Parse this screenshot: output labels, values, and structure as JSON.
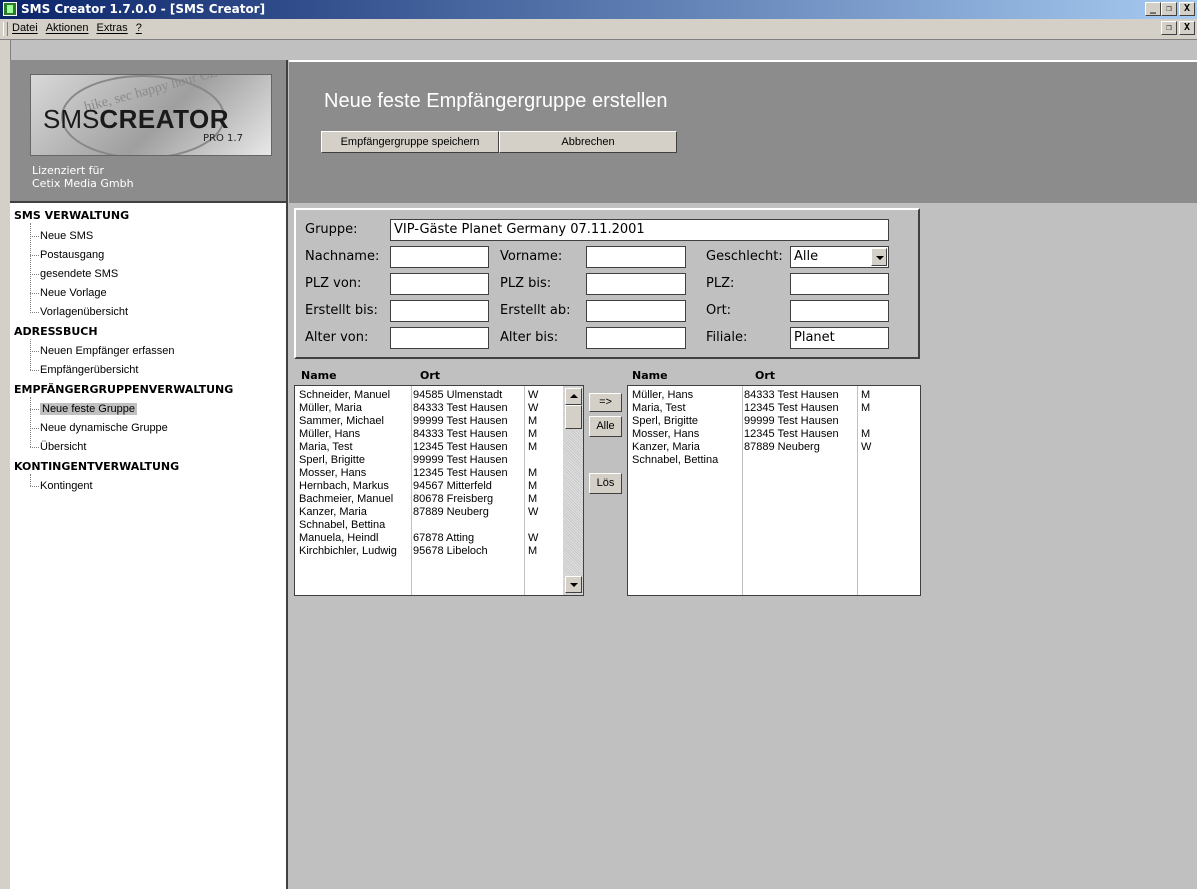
{
  "window": {
    "title": "SMS Creator 1.7.0.0 - [SMS Creator]",
    "buttons": {
      "minimize": "_",
      "restore": "8",
      "close": "X"
    }
  },
  "menubar": {
    "items": [
      "Datei",
      "Aktionen",
      "Extras",
      "?"
    ]
  },
  "sidebar": {
    "logo": {
      "tagline_bg": "hike, sec happy hour CLUB CAIRO ba",
      "word1": "SMS",
      "word2": "CREATOR",
      "edition": "PRO 1.7"
    },
    "license_line1": "Lizenziert für",
    "license_line2": "Cetix Media Gmbh",
    "sections": [
      {
        "title": "SMS VERWALTUNG",
        "items": [
          "Neue SMS",
          "Postausgang",
          "gesendete SMS",
          "Neue Vorlage",
          "Vorlagenübersicht"
        ]
      },
      {
        "title": "ADRESSBUCH",
        "items": [
          "Neuen Empfänger erfassen",
          "Empfängerübersicht"
        ]
      },
      {
        "title": "EMPFÄNGERGRUPPENVERWALTUNG",
        "items": [
          "Neue feste Gruppe",
          "Neue dynamische Gruppe",
          "Übersicht"
        ]
      },
      {
        "title": "KONTINGENTVERWALTUNG",
        "items": [
          "Kontingent"
        ]
      }
    ],
    "selected_item": "Neue feste Gruppe"
  },
  "banner": {
    "title": "Neue feste Empfängergruppe erstellen",
    "save_button": "Empfängergruppe speichern",
    "cancel_button": "Abbrechen"
  },
  "form": {
    "gruppe_label": "Gruppe:",
    "gruppe_value": "VIP-Gäste Planet Germany 07.11.2001",
    "nachname_label": "Nachname:",
    "nachname_value": "",
    "vorname_label": "Vorname:",
    "vorname_value": "",
    "geschlecht_label": "Geschlecht:",
    "geschlecht_value": "Alle",
    "plz_von_label": "PLZ von:",
    "plz_von_value": "",
    "plz_bis_label": "PLZ bis:",
    "plz_bis_value": "",
    "plz_label": "PLZ:",
    "plz_value": "",
    "erstellt_bis_label": "Erstellt bis:",
    "erstellt_bis_value": "",
    "erstellt_ab_label": "Erstellt ab:",
    "erstellt_ab_value": "",
    "ort_label": "Ort:",
    "ort_value": "",
    "alter_von_label": "Alter von:",
    "alter_von_value": "",
    "alter_bis_label": "Alter bis:",
    "alter_bis_value": "",
    "filiale_label": "Filiale:",
    "filiale_value": "Planet"
  },
  "available_list": {
    "headers": {
      "name": "Name",
      "ort": "Ort"
    },
    "rows": [
      {
        "name": "Schneider, Manuel",
        "ort": "94585 Ulmenstadt",
        "sex": "W"
      },
      {
        "name": "Müller, Maria",
        "ort": "84333 Test Hausen",
        "sex": "W"
      },
      {
        "name": "Sammer, Michael",
        "ort": "99999 Test Hausen",
        "sex": "M"
      },
      {
        "name": "Müller, Hans",
        "ort": "84333 Test Hausen",
        "sex": "M"
      },
      {
        "name": "Maria, Test",
        "ort": "12345 Test Hausen",
        "sex": "M"
      },
      {
        "name": "Sperl, Brigitte",
        "ort": "99999 Test Hausen",
        "sex": ""
      },
      {
        "name": "Mosser, Hans",
        "ort": "12345 Test Hausen",
        "sex": "M"
      },
      {
        "name": "Hernbach, Markus",
        "ort": "94567 Mitterfeld",
        "sex": "M"
      },
      {
        "name": "Bachmeier, Manuel",
        "ort": "80678 Freisberg",
        "sex": "M"
      },
      {
        "name": "Kanzer, Maria",
        "ort": "87889 Neuberg",
        "sex": "W"
      },
      {
        "name": "Schnabel, Bettina",
        "ort": "",
        "sex": ""
      },
      {
        "name": "Manuela, Heindl",
        "ort": "67878 Atting",
        "sex": "W"
      },
      {
        "name": "Kirchbichler, Ludwig",
        "ort": "95678 Libeloch",
        "sex": "M"
      }
    ]
  },
  "transfer_buttons": {
    "move": "=>",
    "all": "Alle",
    "remove": "Lös"
  },
  "selected_list": {
    "headers": {
      "name": "Name",
      "ort": "Ort"
    },
    "rows": [
      {
        "name": "Müller, Hans",
        "ort": "84333 Test Hausen",
        "sex": "M"
      },
      {
        "name": "Maria, Test",
        "ort": "12345 Test Hausen",
        "sex": "M"
      },
      {
        "name": "Sperl, Brigitte",
        "ort": "99999 Test Hausen",
        "sex": ""
      },
      {
        "name": "Mosser, Hans",
        "ort": "12345 Test Hausen",
        "sex": "M"
      },
      {
        "name": "Kanzer, Maria",
        "ort": "87889 Neuberg",
        "sex": "W"
      },
      {
        "name": "Schnabel, Bettina",
        "ort": "",
        "sex": ""
      }
    ]
  }
}
